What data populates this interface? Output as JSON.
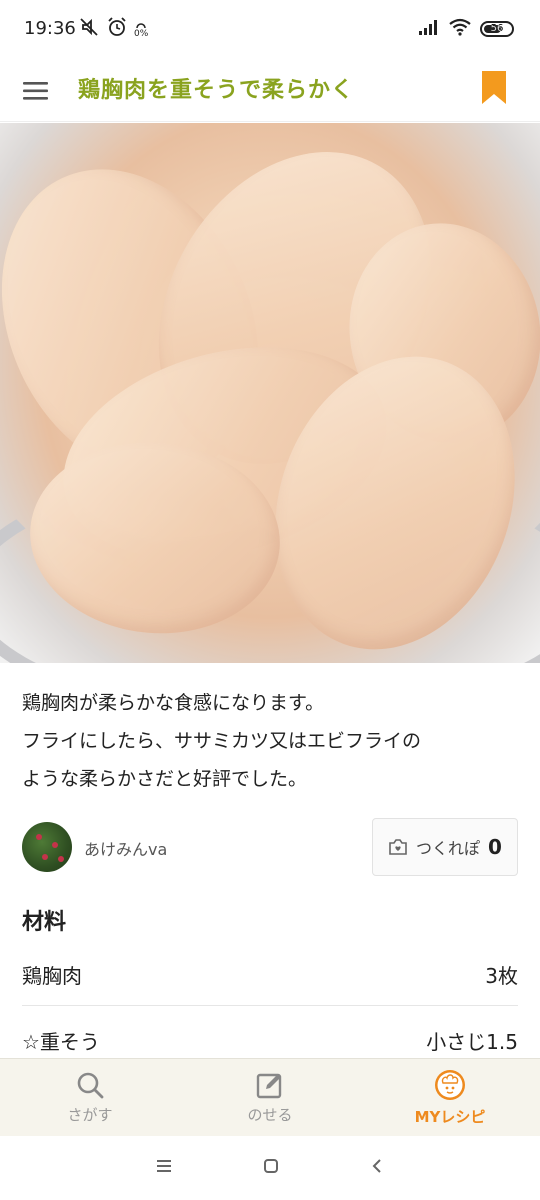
{
  "status_bar": {
    "time": "19:36",
    "battery": "56",
    "icons": [
      "silent-icon",
      "alarm-icon",
      "data-speed-icon",
      "signal-icon",
      "wifi-icon",
      "battery-icon"
    ],
    "data_speed": "0%"
  },
  "header": {
    "title": "鶏胸肉を重そうで柔らかく",
    "accent_color": "#8aa31f",
    "bookmark_color": "#f39a1e"
  },
  "recipe": {
    "description_lines": [
      "鶏胸肉が柔らかな食感になります。",
      "フライにしたら、ササミカツ又はエビフライの",
      "ような柔らかさだと好評でした。"
    ]
  },
  "author": {
    "name": "あけみんva"
  },
  "tsukurepo": {
    "label": "つくれぽ",
    "count": "0"
  },
  "ingredients": {
    "heading": "材料",
    "items": [
      {
        "name": "鶏胸肉",
        "quantity": "3枚"
      },
      {
        "name": "☆重そう",
        "quantity": "小さじ1.5"
      }
    ]
  },
  "tab_bar": {
    "tabs": [
      {
        "label": "さがす",
        "icon": "search-icon",
        "active": false
      },
      {
        "label": "のせる",
        "icon": "edit-icon",
        "active": false
      },
      {
        "label": "MYレシピ",
        "icon": "chef-icon",
        "active": true
      }
    ],
    "active_color": "#ee8a1e"
  },
  "system_nav": {
    "buttons": [
      "recents-icon",
      "home-icon",
      "back-icon"
    ]
  }
}
